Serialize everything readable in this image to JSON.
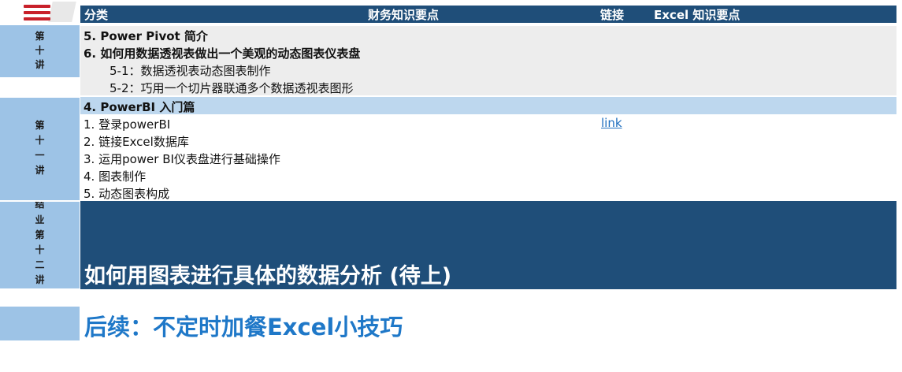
{
  "header": {
    "col_category": "分类",
    "col_knowledge": "财务知识要点",
    "col_link": "链接",
    "col_excel": "Excel 知识要点"
  },
  "lecture10": {
    "side_chars": [
      "第",
      "十",
      "讲"
    ],
    "rows": [
      "5. Power Pivot 简介",
      "6. 如何用数据透视表做出一个美观的动态图表仪表盘",
      "5-1：数据透视表动态图表制作",
      "5-2：巧用一个切片器联通多个数据透视表图形"
    ]
  },
  "lecture11": {
    "side_chars": [
      "第",
      "十",
      "一",
      "讲"
    ],
    "section_title": "4. PowerBI 入门篇",
    "rows": [
      "1. 登录powerBI",
      "2. 链接Excel数据库",
      "3. 运用power BI仪表盘进行基础操作",
      "4. 图表制作",
      "5. 动态图表构成"
    ],
    "link_text": "link"
  },
  "lecture12": {
    "side_chars": [
      "结",
      "业",
      "第",
      "十",
      "二",
      "讲"
    ],
    "title": "如何用图表进行具体的数据分析 (待上)"
  },
  "followup": {
    "title": "后续：不定时加餐Excel小技巧"
  },
  "colors": {
    "navy": "#1f4e79",
    "side_blue": "#9dc3e6",
    "light_blue": "#bdd7ee",
    "grey_band": "#ededed",
    "accent_blue": "#1f78c8"
  }
}
